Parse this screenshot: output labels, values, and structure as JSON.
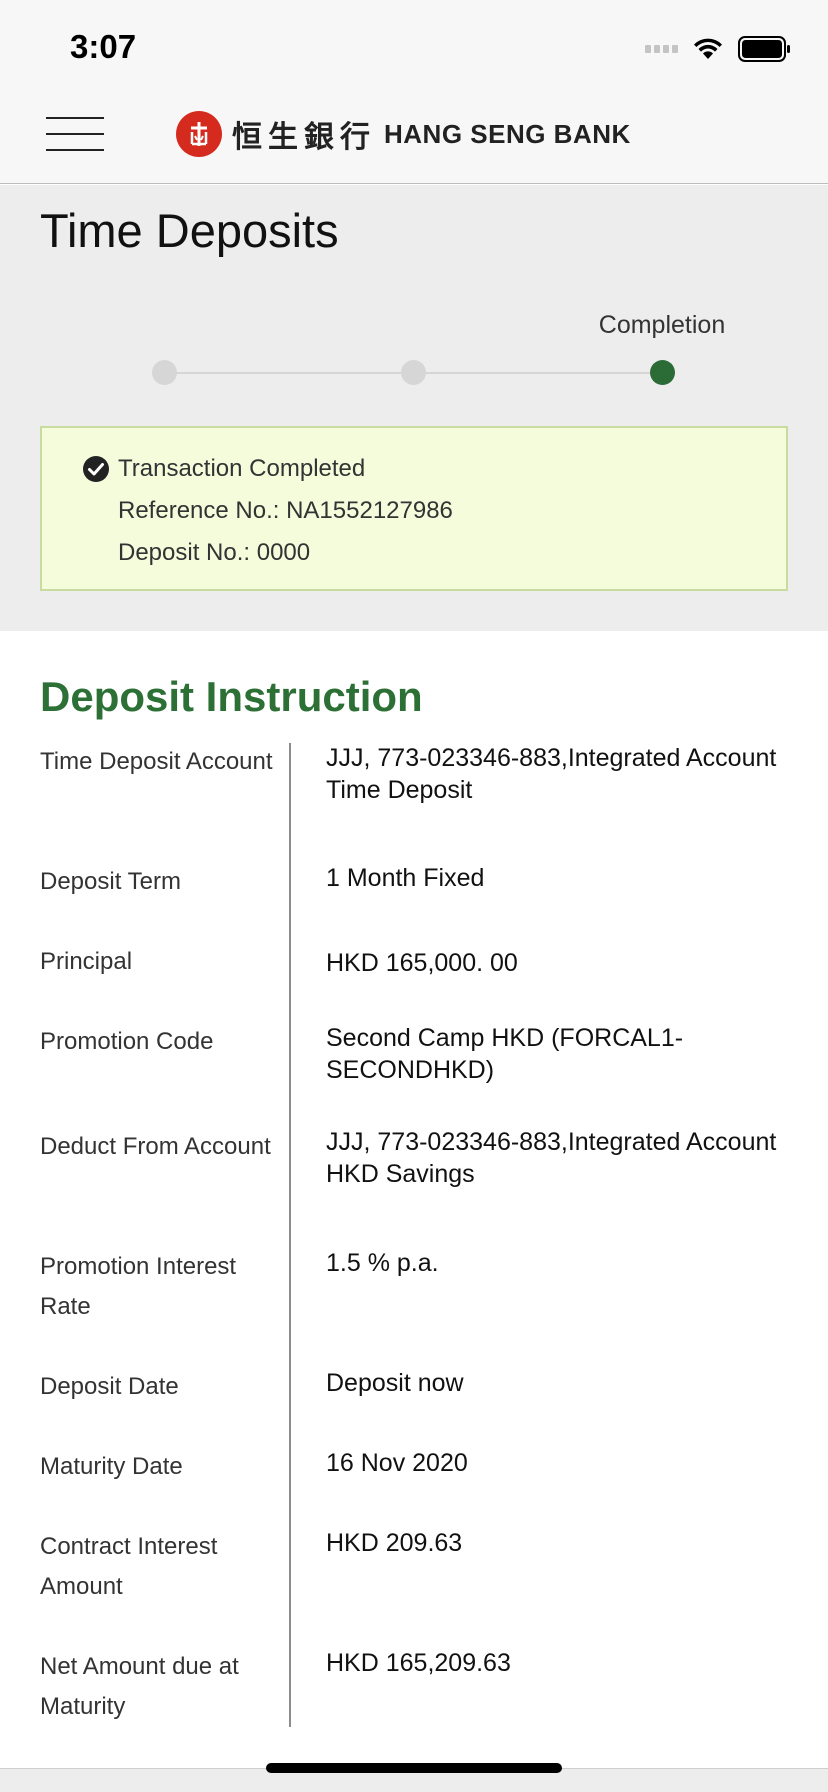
{
  "status_bar": {
    "time": "3:07"
  },
  "header": {
    "logo_cn": "恒生銀行",
    "logo_en": "HANG SENG BANK",
    "brand_color": "#d52b1e"
  },
  "page": {
    "title": "Time Deposits"
  },
  "progress": {
    "current_step_label": "Completion",
    "steps_total": 3,
    "current_step": 3,
    "active_color": "#2b6b35"
  },
  "notice": {
    "status": "Transaction Completed",
    "reference": "Reference No.: NA1552127986",
    "deposit_no": "Deposit No.: 0000"
  },
  "instruction": {
    "title": "Deposit Instruction",
    "rows": [
      {
        "label": "Time Deposit Account",
        "value": "JJJ, 773-023346-883,Integrated Account Time Deposit"
      },
      {
        "label": "Deposit Term",
        "value": "1 Month Fixed"
      },
      {
        "label": "Principal",
        "value": "HKD 165,000. 00"
      },
      {
        "label": "Promotion Code",
        "value": "Second Camp HKD (FORCAL1-SECONDHKD)"
      },
      {
        "label": "Deduct From Account",
        "value": "JJJ, 773-023346-883,Integrated Account HKD Savings"
      },
      {
        "label": "Promotion Interest Rate",
        "value": "1.5 % p.a."
      },
      {
        "label": "Deposit Date",
        "value": "Deposit now"
      },
      {
        "label": "Maturity Date",
        "value": "16 Nov 2020"
      },
      {
        "label": "Contract Interest Amount",
        "value": "HKD 209.63"
      },
      {
        "label": "Net Amount due at Maturity",
        "value": "HKD 165,209.63"
      }
    ]
  }
}
